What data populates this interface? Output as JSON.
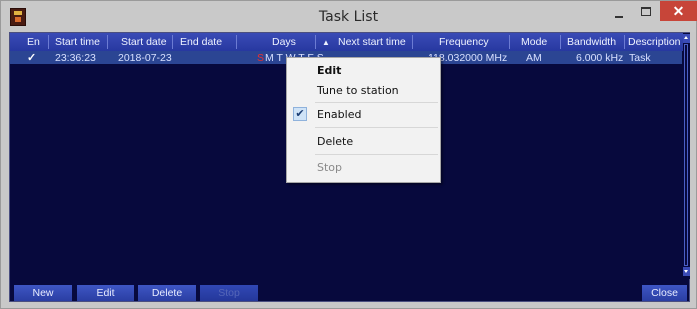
{
  "window": {
    "title": "Task List",
    "close_glyph": "✕"
  },
  "table": {
    "headers": [
      "En",
      "Start time",
      "Start date",
      "End date",
      "Days",
      "Next start time",
      "Frequency",
      "Mode",
      "Bandwidth",
      "Description"
    ],
    "sort_indicator": "▲",
    "rows": [
      {
        "enabled": "✓",
        "start_time": "23:36:23",
        "start_date": "2018-07-23",
        "end_date": "",
        "days_sun": "S",
        "days_rest": "M T W T F S",
        "next_start_time": "",
        "frequency": "118.032000 MHz",
        "mode": "AM",
        "bandwidth": "6.000 kHz",
        "description": "Task"
      }
    ]
  },
  "buttons": {
    "new": "New",
    "edit": "Edit",
    "delete": "Delete",
    "stop": "Stop",
    "close": "Close"
  },
  "context_menu": {
    "items": [
      "Edit",
      "Tune to station",
      "Enabled",
      "Delete",
      "Stop"
    ],
    "enabled_check": "✔"
  }
}
